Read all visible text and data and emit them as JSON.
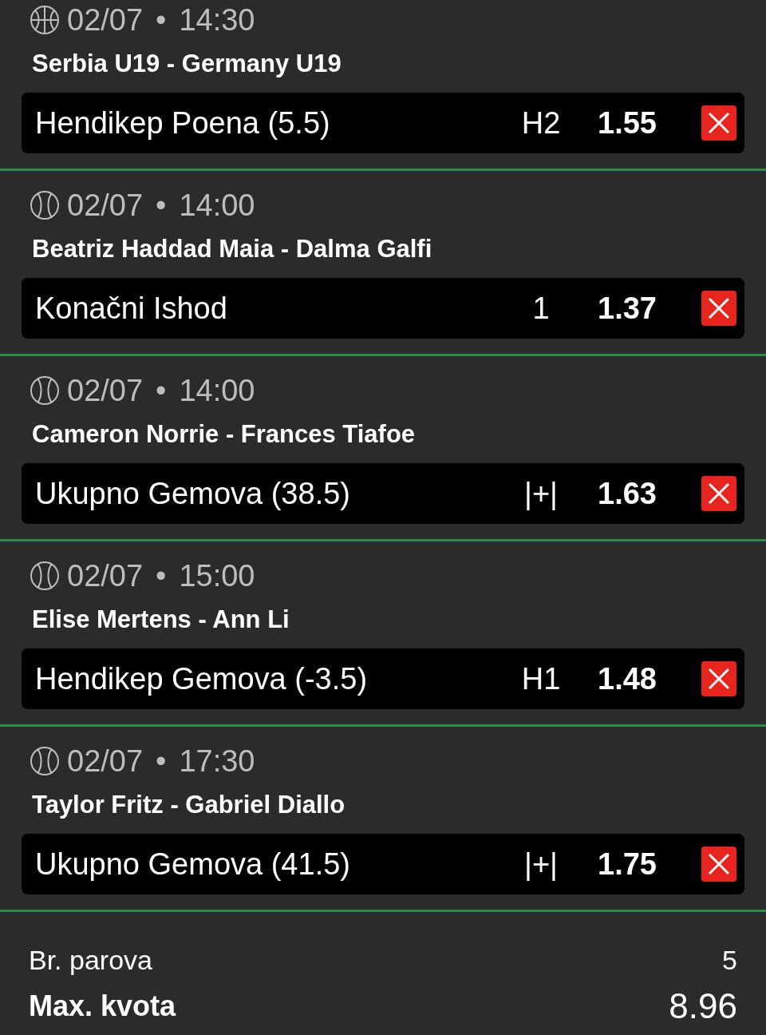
{
  "matches": [
    {
      "kind": "basketball",
      "date": "02/07",
      "separator": "•",
      "time": "14:30",
      "teams": "Serbia U19 - Germany U19",
      "market": "Hendikep Poena (5.5)",
      "pick": "H2",
      "odds": "1.55"
    },
    {
      "kind": "tennis",
      "date": "02/07",
      "separator": "•",
      "time": "14:00",
      "teams": "Beatriz Haddad Maia - Dalma Galfi",
      "market": "Konačni Ishod",
      "pick": "1",
      "odds": "1.37"
    },
    {
      "kind": "tennis",
      "date": "02/07",
      "separator": "•",
      "time": "14:00",
      "teams": "Cameron Norrie - Frances Tiafoe",
      "market": "Ukupno Gemova (38.5)",
      "pick": "|+|",
      "odds": "1.63"
    },
    {
      "kind": "tennis",
      "date": "02/07",
      "separator": "•",
      "time": "15:00",
      "teams": "Elise Mertens - Ann Li",
      "market": "Hendikep Gemova (-3.5)",
      "pick": "H1",
      "odds": "1.48"
    },
    {
      "kind": "tennis",
      "date": "02/07",
      "separator": "•",
      "time": "17:30",
      "teams": "Taylor Fritz - Gabriel Diallo",
      "market": "Ukupno Gemova (41.5)",
      "pick": "|+|",
      "odds": "1.75"
    }
  ],
  "summary": {
    "pairs_label": "Br. parova",
    "pairs_value": "5",
    "max_odds_label": "Max. kvota",
    "max_odds_value": "8.96"
  }
}
